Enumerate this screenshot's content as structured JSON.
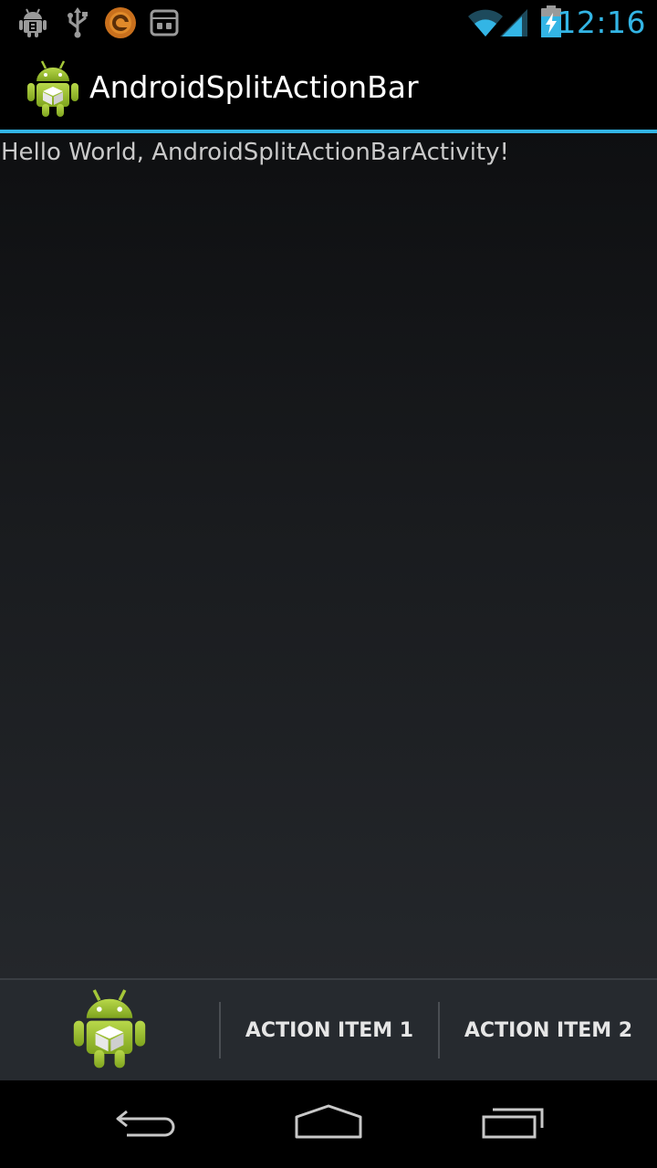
{
  "status_bar": {
    "time": "12:16",
    "icons": [
      "android-debug-icon",
      "usb-icon",
      "sync-app-icon",
      "bbm-icon",
      "wifi-icon",
      "signal-icon",
      "battery-charging-icon"
    ],
    "accent_color": "#33b5e5"
  },
  "action_bar": {
    "title": "AndroidSplitActionBar",
    "icon": "android-app-icon",
    "divider_color": "#33b5e5"
  },
  "content": {
    "text": "Hello World, AndroidSplitActionBarActivity!"
  },
  "split_action_bar": {
    "icon": "android-app-icon",
    "item1_label": "ACTION ITEM 1",
    "item2_label": "ACTION ITEM 2"
  },
  "nav_bar": {
    "buttons": [
      "back-icon",
      "home-icon",
      "recents-icon"
    ]
  }
}
